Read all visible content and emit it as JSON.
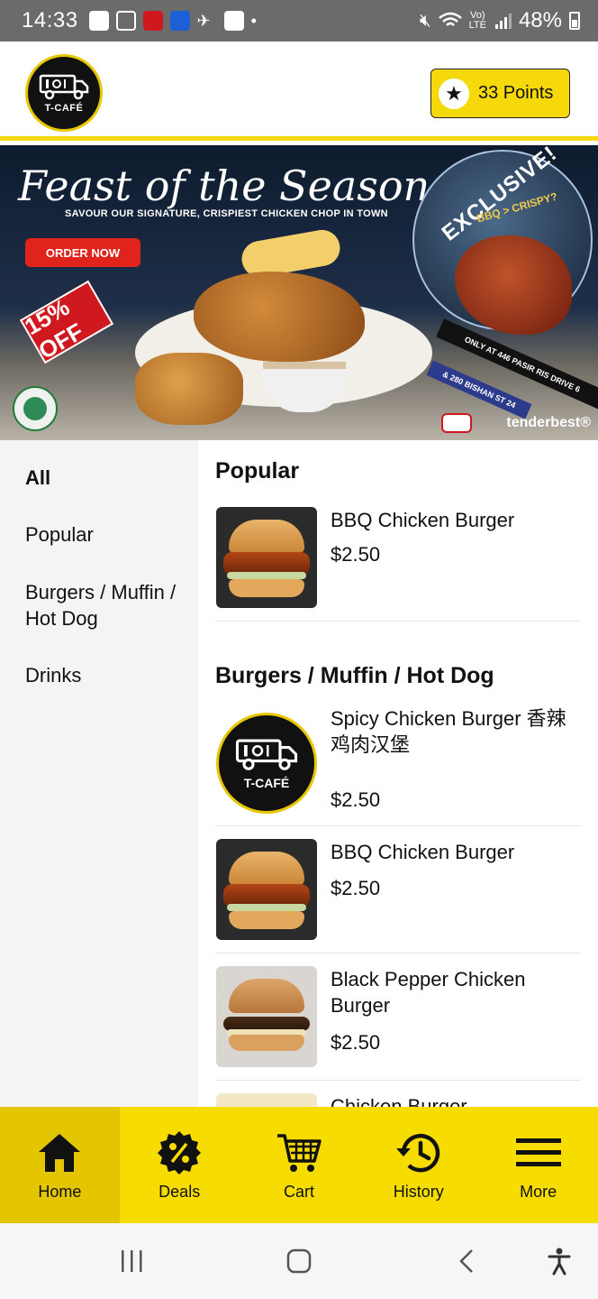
{
  "status_bar": {
    "time": "14:33",
    "dot": "•",
    "battery": "48%"
  },
  "header": {
    "logo_text": "T-CAFÉ",
    "points_label": "33 Points"
  },
  "banner": {
    "title": "Feast of the Season Set",
    "subtitle": "SAVOUR OUR SIGNATURE, CRISPIEST CHICKEN CHOP IN TOWN",
    "order_button": "ORDER NOW",
    "discount": "15% OFF",
    "exclusive": "EXCLUSIVE!",
    "tagline": "BBQ > CRISPY?",
    "location_1": "ONLY AT 446 PASIR RIS DRIVE 6",
    "location_2": "& 280 BISHAN ST 24",
    "brand": "tenderbest®"
  },
  "sidebar": {
    "categories": [
      {
        "label": "All",
        "active": true
      },
      {
        "label": "Popular",
        "active": false
      },
      {
        "label": "Burgers / Muffin / Hot Dog",
        "active": false
      },
      {
        "label": "Drinks",
        "active": false
      }
    ]
  },
  "menu": {
    "sections": [
      {
        "title": "Popular",
        "items": [
          {
            "name": "BBQ Chicken Burger",
            "price": "$2.50",
            "image": "burger-photo"
          }
        ]
      },
      {
        "title": "Burgers / Muffin / Hot Dog",
        "items": [
          {
            "name": "Spicy Chicken Burger 香辣鸡肉汉堡",
            "price": "$2.50",
            "image": "tcafe-logo"
          },
          {
            "name": "BBQ Chicken Burger",
            "price": "$2.50",
            "image": "burger-photo"
          },
          {
            "name": "Black Pepper Chicken Burger",
            "price": "$2.50",
            "image": "black-pepper-burger-photo"
          },
          {
            "name": "Chicken Burger",
            "price": "",
            "image": "burger-photo"
          }
        ]
      }
    ]
  },
  "bottom_nav": {
    "items": [
      {
        "label": "Home",
        "icon": "home-icon",
        "active": true
      },
      {
        "label": "Deals",
        "icon": "percent-badge-icon",
        "active": false
      },
      {
        "label": "Cart",
        "icon": "cart-icon",
        "active": false
      },
      {
        "label": "History",
        "icon": "history-icon",
        "active": false
      },
      {
        "label": "More",
        "icon": "menu-icon",
        "active": false
      }
    ]
  },
  "colors": {
    "brand_yellow": "#f7dc00",
    "active_nav": "#e3c600",
    "sidebar_bg": "#f4f4f4",
    "status_bar": "#6b6b6b"
  }
}
